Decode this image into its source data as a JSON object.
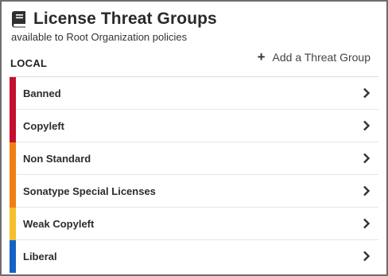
{
  "header": {
    "title": "License Threat Groups",
    "subtitle": "available to Root Organization policies",
    "icon": "book-icon"
  },
  "section": {
    "label": "LOCAL"
  },
  "actions": {
    "add_label": "Add a Threat Group",
    "add_icon": "plus-icon"
  },
  "groups": [
    {
      "label": "Banned",
      "color": "#c4102c"
    },
    {
      "label": "Copyleft",
      "color": "#c4102c"
    },
    {
      "label": "Non Standard",
      "color": "#f07f14"
    },
    {
      "label": "Sonatype Special Licenses",
      "color": "#f07f14"
    },
    {
      "label": "Weak Copyleft",
      "color": "#f5c02a"
    },
    {
      "label": "Liberal",
      "color": "#1363c5"
    }
  ]
}
